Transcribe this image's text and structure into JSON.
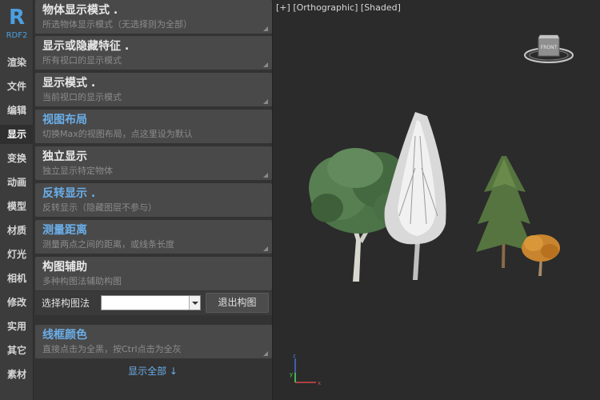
{
  "app": {
    "logo": "R",
    "version": "RDF2"
  },
  "nav": [
    {
      "label": "渲染"
    },
    {
      "label": "文件"
    },
    {
      "label": "编辑"
    },
    {
      "label": "显示"
    },
    {
      "label": "变换"
    },
    {
      "label": "动画"
    },
    {
      "label": "模型"
    },
    {
      "label": "材质"
    },
    {
      "label": "灯光"
    },
    {
      "label": "相机"
    },
    {
      "label": "修改"
    },
    {
      "label": "实用"
    },
    {
      "label": "其它"
    },
    {
      "label": "素材"
    }
  ],
  "nav_active": "显示",
  "cards": [
    {
      "title": "物体显示模式 .",
      "desc": "所选物体显示模式（无选择则为全部）"
    },
    {
      "title": "显示或隐藏特征 .",
      "desc": "所有视口的显示模式"
    },
    {
      "title": "显示模式 .",
      "desc": "当前视口的显示模式"
    },
    {
      "title": "视图布局",
      "desc": "切换Max的视图布局，点这里设为默认"
    },
    {
      "title": "独立显示",
      "desc": "独立显示特定物体"
    },
    {
      "title": "反转显示 .",
      "desc": "反转显示（隐藏图层不参与）"
    },
    {
      "title": "测量距离",
      "desc": "测量两点之间的距离，或线条长度"
    },
    {
      "title": "构图辅助",
      "desc": "多种构图法辅助构图"
    },
    {
      "title": "线框颜色",
      "desc": "直接点击为全黑，按Ctrl点击为全灰"
    }
  ],
  "composition": {
    "label": "选择构图法",
    "selected": "",
    "exit_button": "退出构图"
  },
  "show_all": "显示全部 ↓",
  "viewport": {
    "label_plus": "[+]",
    "label_view": "[Orthographic]",
    "label_shade": "[Shaded]",
    "viewcube_face": "FRONT",
    "axis_x": "x",
    "axis_y": "y",
    "axis_z": "z"
  },
  "colors": {
    "accent": "#6aaee9",
    "panel": "#333333",
    "card": "#494949",
    "viewport": "#2b2b2b"
  }
}
